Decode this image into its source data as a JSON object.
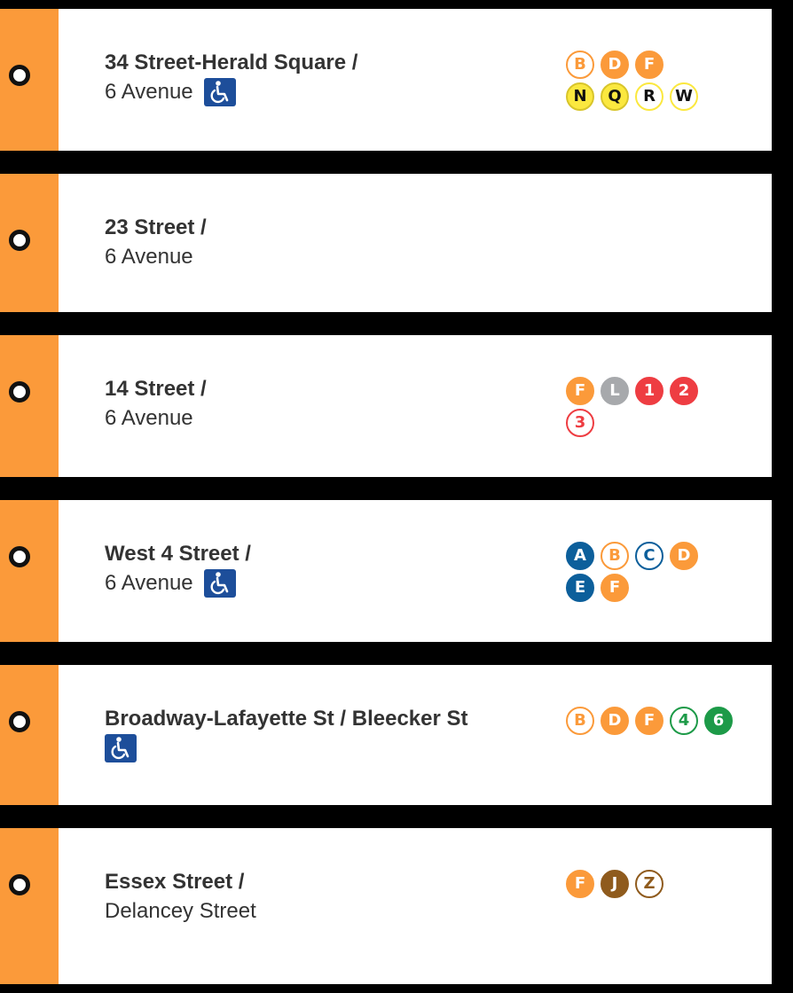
{
  "colors": {
    "strip": "#fb9a3a",
    "orange": "#fb9a3a",
    "yellow": "#fbe83f",
    "red": "#ee3d42",
    "gray": "#a7a9ac",
    "blue": "#0c5f9b",
    "green": "#1d9a48",
    "brown": "#8f5b1d",
    "access": "#1d4e9a"
  },
  "stations": [
    {
      "name_line1": "34 Street-Herald Square /",
      "name_line2": "6 Avenue",
      "accessible": true,
      "routes": [
        [
          {
            "label": "B",
            "color": "orange",
            "style": "outline"
          },
          {
            "label": "D",
            "color": "orange",
            "style": "solid"
          },
          {
            "label": "F",
            "color": "orange",
            "style": "solid"
          }
        ],
        [
          {
            "label": "N",
            "color": "yellow",
            "style": "solid-dark"
          },
          {
            "label": "Q",
            "color": "yellow",
            "style": "solid-dark"
          },
          {
            "label": "R",
            "color": "yellow",
            "style": "outline-dark"
          },
          {
            "label": "W",
            "color": "yellow",
            "style": "outline-dark"
          }
        ]
      ]
    },
    {
      "name_line1": "23 Street /",
      "name_line2": "6 Avenue",
      "accessible": false,
      "routes": []
    },
    {
      "name_line1": "14 Street /",
      "name_line2": "6 Avenue",
      "accessible": false,
      "routes": [
        [
          {
            "label": "F",
            "color": "orange",
            "style": "solid"
          },
          {
            "label": "L",
            "color": "gray",
            "style": "solid"
          },
          {
            "label": "1",
            "color": "red",
            "style": "solid"
          },
          {
            "label": "2",
            "color": "red",
            "style": "solid"
          }
        ],
        [
          {
            "label": "3",
            "color": "red",
            "style": "outline"
          }
        ]
      ]
    },
    {
      "name_line1": "West 4 Street /",
      "name_line2": "6 Avenue",
      "accessible": true,
      "routes": [
        [
          {
            "label": "A",
            "color": "blue",
            "style": "solid"
          },
          {
            "label": "B",
            "color": "orange",
            "style": "outline"
          },
          {
            "label": "C",
            "color": "blue",
            "style": "outline"
          },
          {
            "label": "D",
            "color": "orange",
            "style": "solid"
          }
        ],
        [
          {
            "label": "E",
            "color": "blue",
            "style": "solid"
          },
          {
            "label": "F",
            "color": "orange",
            "style": "solid"
          }
        ]
      ]
    },
    {
      "name_line1": "Broadway-Lafayette St / Bleecker St",
      "name_line2": "",
      "accessible": true,
      "routes": [
        [
          {
            "label": "B",
            "color": "orange",
            "style": "outline"
          },
          {
            "label": "D",
            "color": "orange",
            "style": "solid"
          },
          {
            "label": "F",
            "color": "orange",
            "style": "solid"
          },
          {
            "label": "4",
            "color": "green",
            "style": "outline"
          },
          {
            "label": "6",
            "color": "green",
            "style": "solid"
          }
        ]
      ]
    },
    {
      "name_line1": "Essex Street /",
      "name_line2": "Delancey Street",
      "accessible": false,
      "routes": [
        [
          {
            "label": "F",
            "color": "orange",
            "style": "solid"
          },
          {
            "label": "J",
            "color": "brown",
            "style": "solid"
          },
          {
            "label": "Z",
            "color": "brown",
            "style": "outline"
          }
        ]
      ]
    }
  ]
}
